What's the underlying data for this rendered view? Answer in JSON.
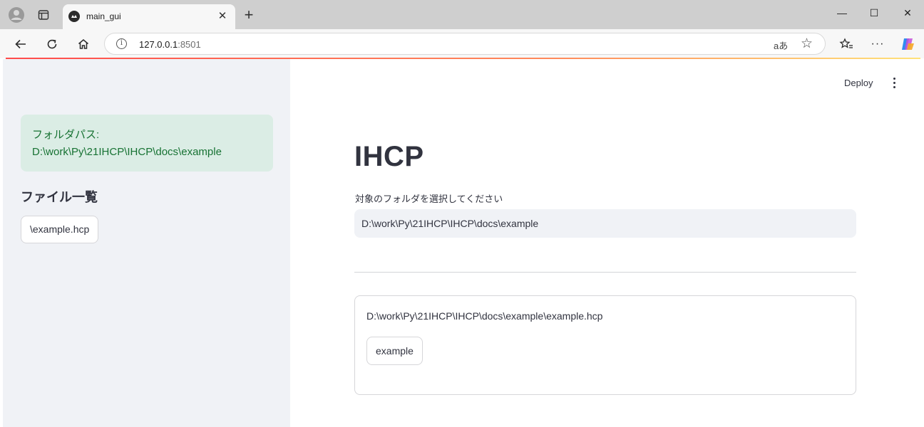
{
  "browser": {
    "tab_title": "main_gui",
    "url_host": "127.0.0.1",
    "url_port": ":8501",
    "translate_glyph": "aあ"
  },
  "sidebar": {
    "success_label": "フォルダパス:",
    "success_path": "D:\\work\\Py\\21IHCP\\IHCP\\docs\\example",
    "file_list_heading": "ファイル一覧",
    "files": [
      "\\example.hcp"
    ]
  },
  "header": {
    "deploy_label": "Deploy"
  },
  "main": {
    "title": "IHCP",
    "folder_input_label": "対象のフォルダを選択してください",
    "folder_input_value": "D:\\work\\Py\\21IHCP\\IHCP\\docs\\example",
    "card": {
      "file_path": "D:\\work\\Py\\21IHCP\\IHCP\\docs\\example\\example.hcp",
      "button_label": "example"
    }
  },
  "colors": {
    "sidebar_bg": "#f0f2f6",
    "success_bg": "#dbede5",
    "success_text": "#177233",
    "text": "#31333f"
  }
}
